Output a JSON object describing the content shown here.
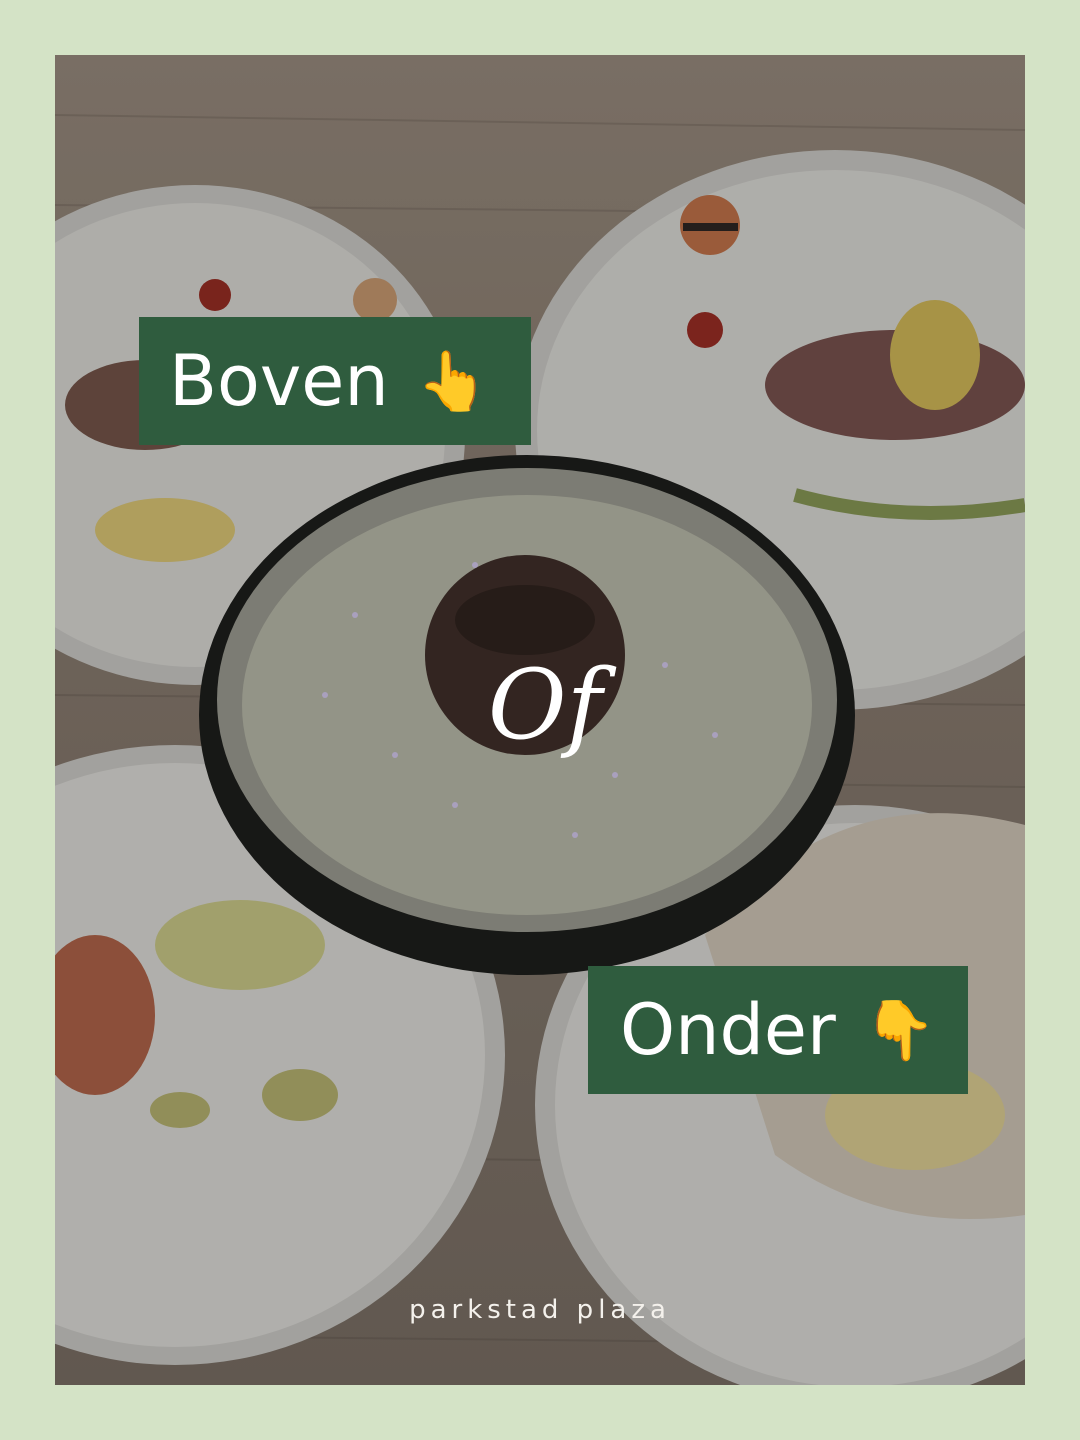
{
  "overlay": {
    "top_label": "Boven",
    "top_emoji": "👆",
    "middle_word": "Of",
    "bottom_label": "Onder",
    "bottom_emoji": "👇",
    "brand": "parkstad plaza"
  },
  "colors": {
    "page_background": "#d4e3c6",
    "label_background": "#2f5c3e",
    "label_text": "#ffffff"
  },
  "photo": {
    "subject": "five plated dishes on wooden table with lava cake in black bowl at center"
  }
}
